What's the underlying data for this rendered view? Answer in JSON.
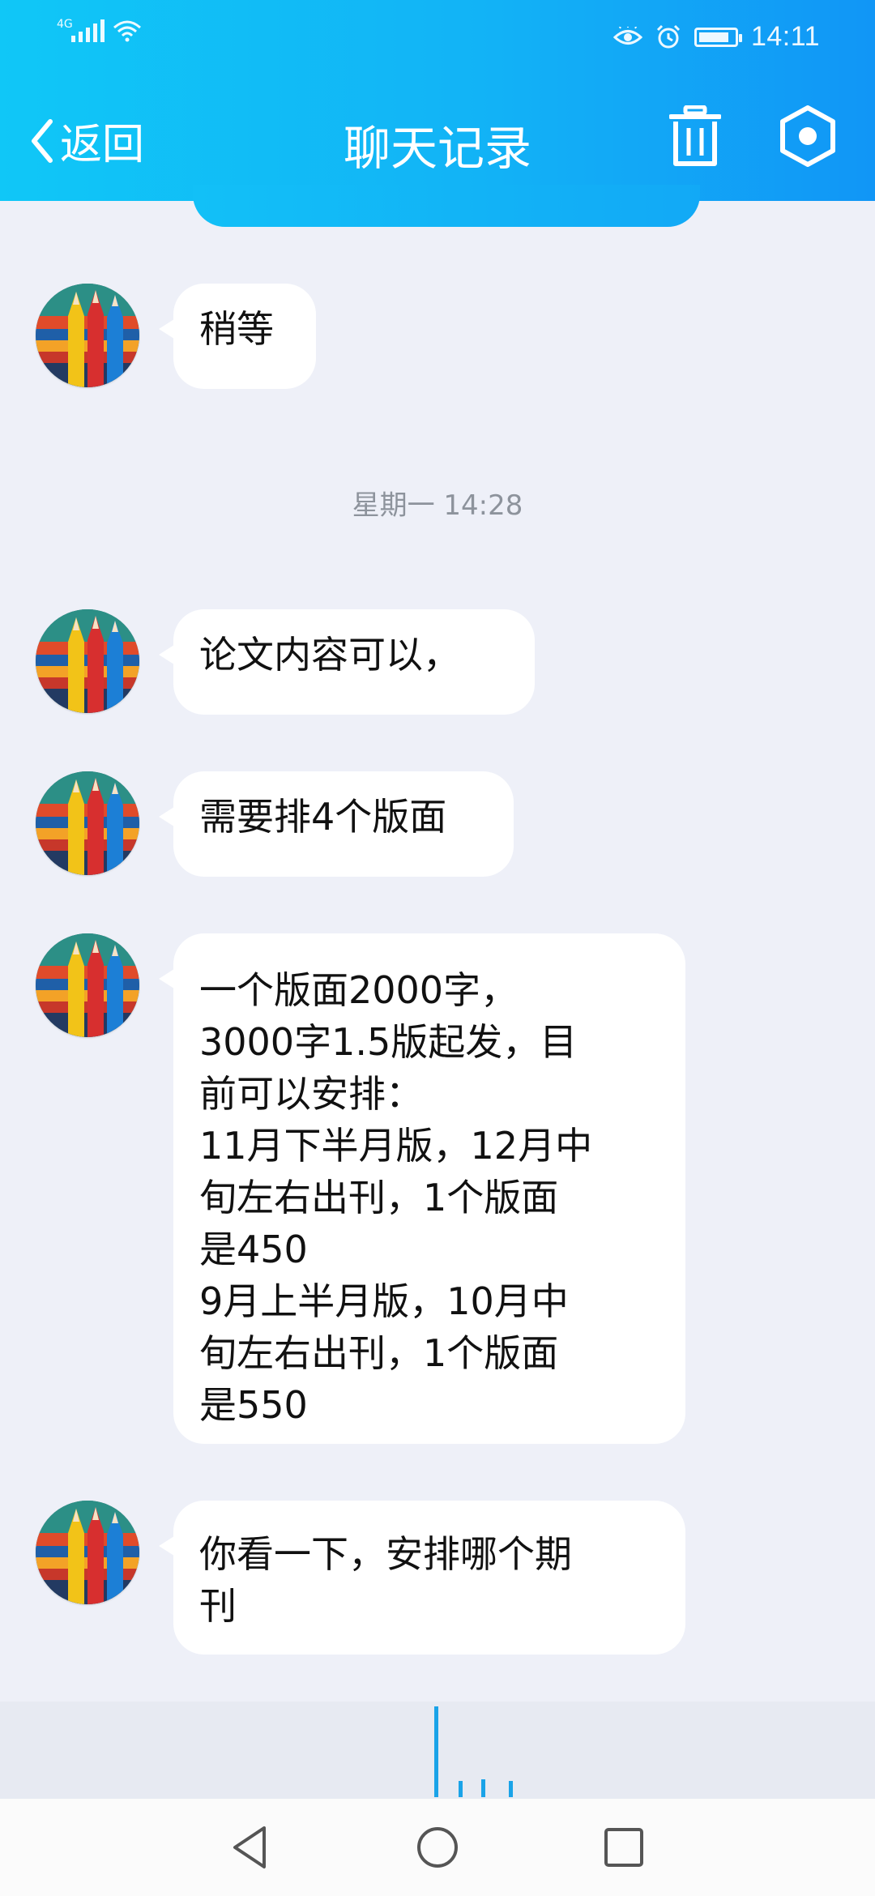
{
  "status_bar": {
    "network": "4G",
    "time": "14:11",
    "battery_level": 0.85
  },
  "nav": {
    "back_label": "返回",
    "title": "聊天记录"
  },
  "messages_before": [
    {
      "text": "稍等"
    }
  ],
  "timestamp": "星期一 14:28",
  "messages": [
    {
      "text": "论文内容可以，"
    },
    {
      "text": "需要排4个版面"
    },
    {
      "text": "一个版面2000字，\n3000字1.5版起发，目\n前可以安排：\n11月下半月版，12月中\n旬左右出刊，1个版面\n是450\n9月上半月版，10月中\n旬左右出刊，1个版面\n是550"
    },
    {
      "text": "你看一下，安排哪个期\n刊"
    }
  ],
  "icons": {
    "back": "chevron-left-icon",
    "trash": "trash-icon",
    "settings": "hexagon-settings-icon",
    "nav_back": "triangle-back-icon",
    "nav_home": "circle-home-icon",
    "nav_recent": "square-recent-icon",
    "status_eye": "eye-icon",
    "status_alarm": "alarm-icon",
    "status_wifi": "wifi-icon"
  },
  "colors": {
    "header_start": "#10c7f7",
    "header_end": "#1196f6",
    "background": "#eef0f8",
    "bubble": "#ffffff",
    "timestamp_text": "#8d939c",
    "voice_bar": "#1aa3e8"
  }
}
